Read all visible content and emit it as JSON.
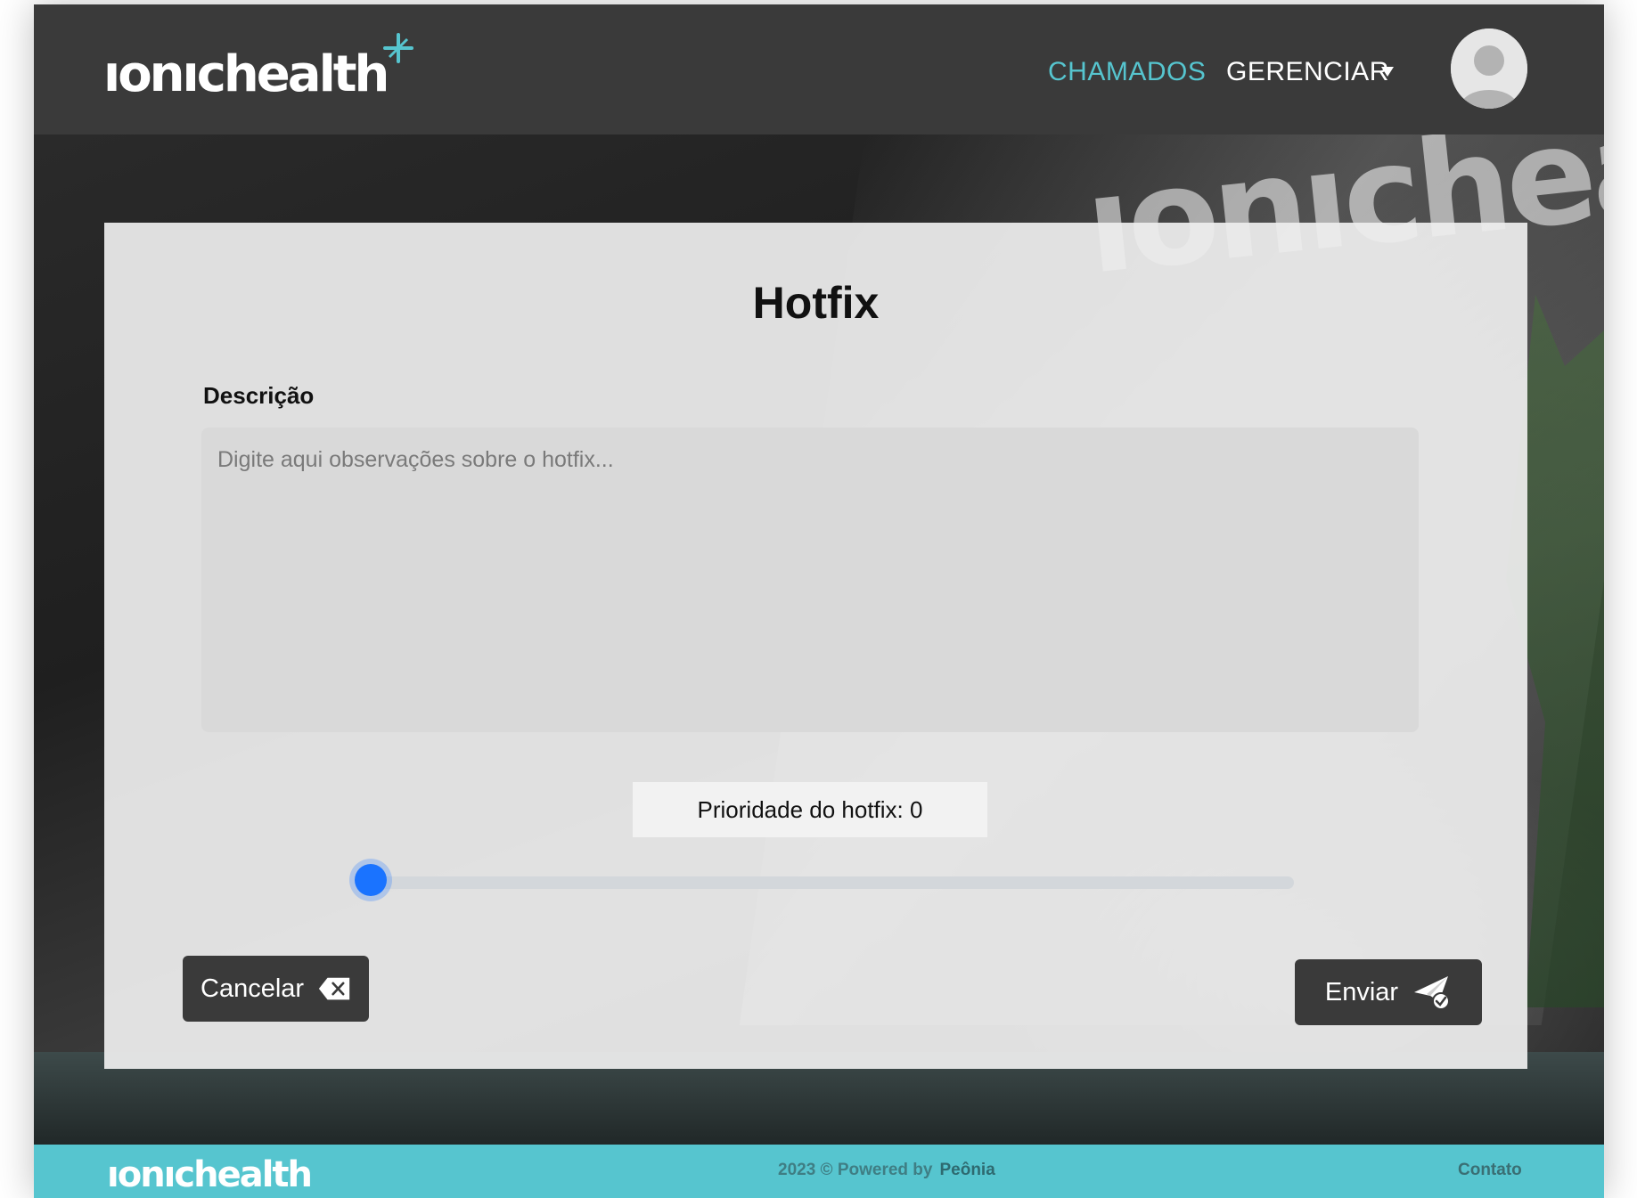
{
  "header": {
    "logo_text": "ıonıchealth",
    "nav": {
      "chamados": "CHAMADOS",
      "gerenciar": "GERENCIAR"
    }
  },
  "background": {
    "sign_text": "ıonıcheal"
  },
  "form": {
    "title": "Hotfix",
    "description_label": "Descrição",
    "description_placeholder": "Digite aqui observações sobre o hotfix...",
    "description_value": "",
    "priority_label": "Prioridade do hotfix: 0",
    "priority_value": 0,
    "priority_min": 0,
    "priority_max": 10,
    "cancel_label": "Cancelar",
    "send_label": "Enviar"
  },
  "footer": {
    "logo_text": "ıonıchealth",
    "copyright": "2023 © Powered by",
    "brand": "Peônia",
    "contact": "Contato"
  },
  "colors": {
    "accent": "#56c5cf",
    "header_bg": "#3a3a3a",
    "button_bg": "#3a3a3a",
    "slider_thumb": "#1a73ff"
  },
  "icons": {
    "cancel": "backspace-x-icon",
    "send": "paper-plane-check-icon",
    "caret": "caret-down-icon",
    "avatar": "user-avatar-icon",
    "logo_mark": "plus-swirl-icon"
  }
}
